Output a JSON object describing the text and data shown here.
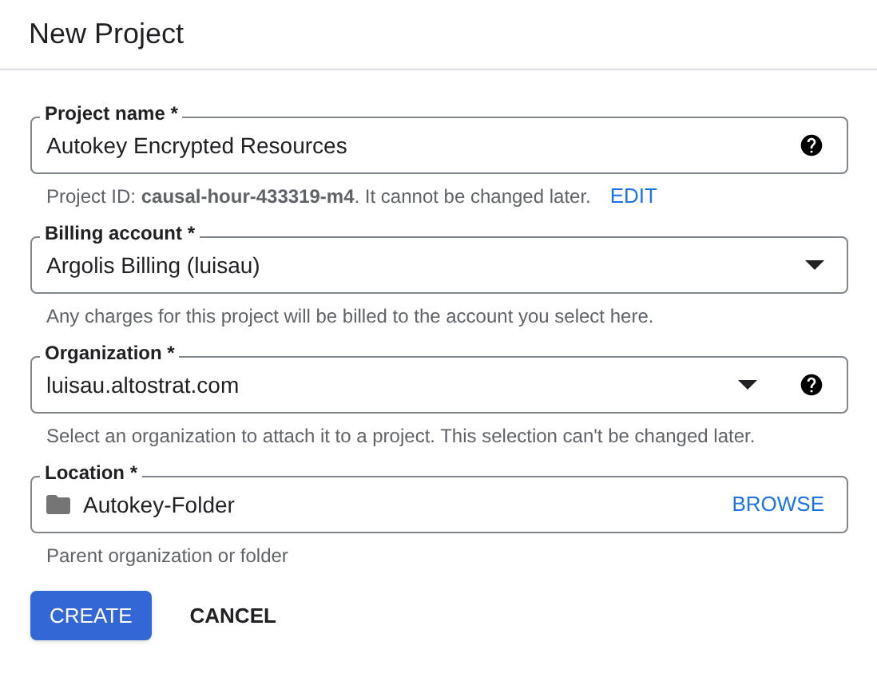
{
  "title": "New Project",
  "fields": [
    {
      "kind": "text",
      "label": "Project name *",
      "value": "Autokey Encrypted Resources",
      "help": true,
      "hint": "Project ID: **causal-hour-433319-m4**. It cannot be changed later.",
      "hint_link": "EDIT"
    },
    {
      "kind": "select",
      "label": "Billing account *",
      "value": "Argolis Billing (luisau)",
      "help": false,
      "hint": "Any charges for this project will be billed to the account you select here."
    },
    {
      "kind": "select",
      "label": "Organization *",
      "value": "luisau.altostrat.com",
      "help": true,
      "hint": "Select an organization to attach it to a project. This selection can't be changed later."
    },
    {
      "kind": "location",
      "label": "Location *",
      "value": "Autokey-Folder",
      "action": "BROWSE",
      "help": false,
      "hint": "Parent organization or folder"
    }
  ],
  "buttons": [
    {
      "label": "CREATE",
      "kind": "primary"
    },
    {
      "label": "CANCEL",
      "kind": "text"
    }
  ]
}
